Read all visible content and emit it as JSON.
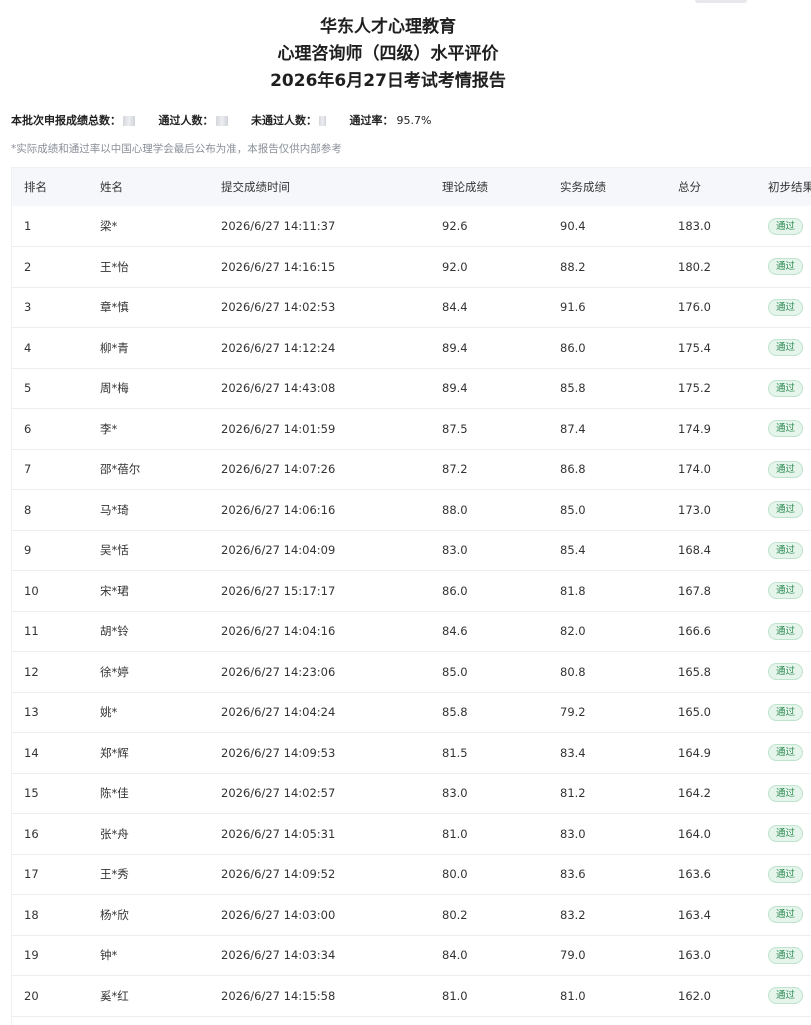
{
  "header": {
    "org": "华东人才心理教育",
    "exam": "心理咨询师（四级）水平评价",
    "report": "2026年6月27日考试考情报告"
  },
  "summary": {
    "total_label": "本批次申报成绩总数：",
    "pass_label": "通过人数：",
    "fail_label": "未通过人数：",
    "rate_label": "通过率：",
    "rate_value": "95.7%"
  },
  "note": "*实际成绩和通过率以中国心理学会最后公布为准，本报告仅供内部参考",
  "table": {
    "headers": [
      "排名",
      "姓名",
      "提交成绩时间",
      "理论成绩",
      "实务成绩",
      "总分",
      "初步结果"
    ],
    "rows": [
      {
        "rank": "1",
        "name": "梁*",
        "time": "2026/6/27 14:11:37",
        "theory": "92.6",
        "practice": "90.4",
        "total": "183.0",
        "result": "通过"
      },
      {
        "rank": "2",
        "name": "王*怡",
        "time": "2026/6/27 14:16:15",
        "theory": "92.0",
        "practice": "88.2",
        "total": "180.2",
        "result": "通过"
      },
      {
        "rank": "3",
        "name": "章*慎",
        "time": "2026/6/27 14:02:53",
        "theory": "84.4",
        "practice": "91.6",
        "total": "176.0",
        "result": "通过"
      },
      {
        "rank": "4",
        "name": "柳*青",
        "time": "2026/6/27 14:12:24",
        "theory": "89.4",
        "practice": "86.0",
        "total": "175.4",
        "result": "通过"
      },
      {
        "rank": "5",
        "name": "周*梅",
        "time": "2026/6/27 14:43:08",
        "theory": "89.4",
        "practice": "85.8",
        "total": "175.2",
        "result": "通过"
      },
      {
        "rank": "6",
        "name": "李*",
        "time": "2026/6/27 14:01:59",
        "theory": "87.5",
        "practice": "87.4",
        "total": "174.9",
        "result": "通过"
      },
      {
        "rank": "7",
        "name": "邵*蓓尔",
        "time": "2026/6/27 14:07:26",
        "theory": "87.2",
        "practice": "86.8",
        "total": "174.0",
        "result": "通过"
      },
      {
        "rank": "8",
        "name": "马*琦",
        "time": "2026/6/27 14:06:16",
        "theory": "88.0",
        "practice": "85.0",
        "total": "173.0",
        "result": "通过"
      },
      {
        "rank": "9",
        "name": "吴*恬",
        "time": "2026/6/27 14:04:09",
        "theory": "83.0",
        "practice": "85.4",
        "total": "168.4",
        "result": "通过"
      },
      {
        "rank": "10",
        "name": "宋*珺",
        "time": "2026/6/27 15:17:17",
        "theory": "86.0",
        "practice": "81.8",
        "total": "167.8",
        "result": "通过"
      },
      {
        "rank": "11",
        "name": "胡*铃",
        "time": "2026/6/27 14:04:16",
        "theory": "84.6",
        "practice": "82.0",
        "total": "166.6",
        "result": "通过"
      },
      {
        "rank": "12",
        "name": "徐*婷",
        "time": "2026/6/27 14:23:06",
        "theory": "85.0",
        "practice": "80.8",
        "total": "165.8",
        "result": "通过"
      },
      {
        "rank": "13",
        "name": "姚*",
        "time": "2026/6/27 14:04:24",
        "theory": "85.8",
        "practice": "79.2",
        "total": "165.0",
        "result": "通过"
      },
      {
        "rank": "14",
        "name": "郑*辉",
        "time": "2026/6/27 14:09:53",
        "theory": "81.5",
        "practice": "83.4",
        "total": "164.9",
        "result": "通过"
      },
      {
        "rank": "15",
        "name": "陈*佳",
        "time": "2026/6/27 14:02:57",
        "theory": "83.0",
        "practice": "81.2",
        "total": "164.2",
        "result": "通过"
      },
      {
        "rank": "16",
        "name": "张*舟",
        "time": "2026/6/27 14:05:31",
        "theory": "81.0",
        "practice": "83.0",
        "total": "164.0",
        "result": "通过"
      },
      {
        "rank": "17",
        "name": "王*秀",
        "time": "2026/6/27 14:09:52",
        "theory": "80.0",
        "practice": "83.6",
        "total": "163.6",
        "result": "通过"
      },
      {
        "rank": "18",
        "name": "杨*欣",
        "time": "2026/6/27 14:03:00",
        "theory": "80.2",
        "practice": "83.2",
        "total": "163.4",
        "result": "通过"
      },
      {
        "rank": "19",
        "name": "钟*",
        "time": "2026/6/27 14:03:34",
        "theory": "84.0",
        "practice": "79.0",
        "total": "163.0",
        "result": "通过"
      },
      {
        "rank": "20",
        "name": "奚*红",
        "time": "2026/6/27 14:15:58",
        "theory": "81.0",
        "practice": "81.0",
        "total": "162.0",
        "result": "通过"
      }
    ]
  },
  "colors": {
    "header_bg": "#f5f7fa",
    "pass_text": "#2d8a52",
    "pass_bg": "#e6f5ec",
    "note_text": "#8a8f98"
  }
}
